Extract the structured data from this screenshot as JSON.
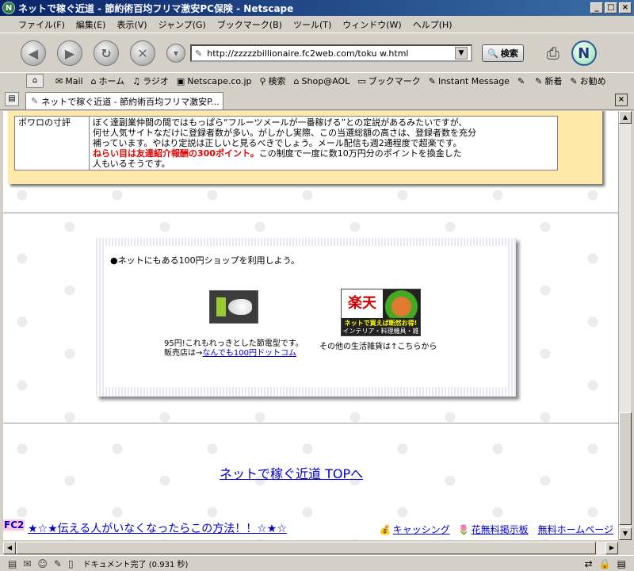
{
  "window": {
    "title": "ネットで稼ぐ近道 - 節約術百均フリマ激安PC保険 - Netscape",
    "app_icon": "netscape-n-icon"
  },
  "menu": [
    "ファイル(F)",
    "編集(E)",
    "表示(V)",
    "ジャンプ(G)",
    "ブックマーク(B)",
    "ツール(T)",
    "ウィンドウ(W)",
    "ヘルプ(H)"
  ],
  "nav": {
    "url": "http://zzzzzbillionaire.fc2web.com/toku w.html",
    "search_label": "検索"
  },
  "personal_toolbar": [
    {
      "icon": "mail-icon",
      "label": "Mail"
    },
    {
      "icon": "home-icon",
      "label": "ホーム"
    },
    {
      "icon": "radio-icon",
      "label": "ラジオ"
    },
    {
      "icon": "netscape-icon",
      "label": "Netscape.co.jp"
    },
    {
      "icon": "search-icon",
      "label": "検索"
    },
    {
      "icon": "aol-icon",
      "label": "Shop@AOL"
    },
    {
      "icon": "bookmark-folder-icon",
      "label": "ブックマーク"
    },
    {
      "icon": "im-icon",
      "label": "Instant Message"
    },
    {
      "icon": "bookmark-icon",
      "label": ""
    },
    {
      "icon": "bookmark-icon",
      "label": "新着"
    },
    {
      "icon": "bookmark-icon",
      "label": "お勧め"
    }
  ],
  "tab": {
    "label": "ネットで稼ぐ近道 - 節約術百均フリマ激安P..."
  },
  "content": {
    "table_label": "ポワロの寸評",
    "table_text_1": "ぼく達副業仲間の間ではもっぱら“フルーツメールが一番稼げる”との定説があるみたいですが、",
    "table_text_2": "何せ人気サイトなだけに登録者数が多い。がしかし実際、この当選総額の高さは、登録者数を充分",
    "table_text_3": "補っています。やはり定説は正しいと見るべきでしょう。メール配信も週2通程度で超楽です。",
    "table_text_red": "ねらい目は友達紹介報酬の300ポイント。",
    "table_text_4": "この制度で一度に数10万円分のポイントを換金した",
    "table_text_5": "人もいるそうです。",
    "promo_heading": "●ネットにもある100円ショップを利用しよう。",
    "bulb_caption_1": "95円!これもれっきとした節電型です。",
    "bulb_caption_2": "販売店は→",
    "bulb_link": "なんでも100円ドットコム",
    "rakuten_logo": "楽天",
    "rakuten_line_1": "ネットで買えば断然お得!",
    "rakuten_line_2": "インテリア・料理機具・雑貨",
    "rakuten_caption": "その他の生活雑貨は↑こちらから",
    "top_link": "ネットで稼ぐ近道  TOPへ",
    "fc2_badge": "FC2",
    "footer_promo": "★☆★伝える人がいなくなったらこの方法！！☆★☆",
    "footer_cashing": "キャッシング",
    "footer_bbs": "花無料掲示板",
    "footer_homepage": "無料ホームページ"
  },
  "status": {
    "text": "ドキュメント完了 (0.931 秒)"
  }
}
